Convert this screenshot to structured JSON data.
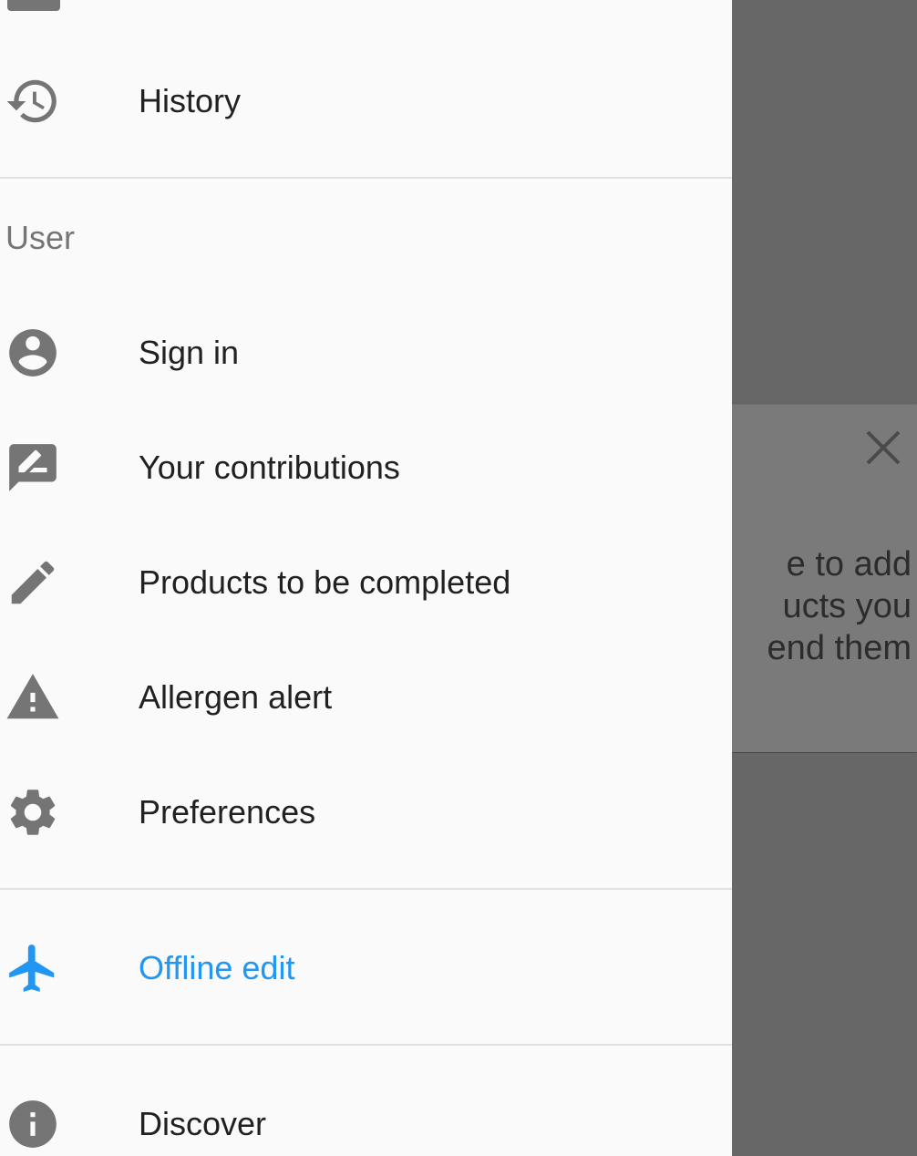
{
  "background": {
    "card_text_lines": [
      "e to add",
      "ucts you",
      "end them"
    ],
    "close_icon": "close-icon"
  },
  "drawer": {
    "history_label": "History",
    "section_user": "User",
    "items": [
      {
        "label": "Sign in",
        "icon": "account-circle-icon"
      },
      {
        "label": "Your contributions",
        "icon": "rate-review-icon"
      },
      {
        "label": "Products to be completed",
        "icon": "pencil-icon"
      },
      {
        "label": "Allergen alert",
        "icon": "warning-icon"
      },
      {
        "label": "Preferences",
        "icon": "gear-icon"
      }
    ],
    "offline_edit_label": "Offline edit",
    "discover_label": "Discover"
  },
  "colors": {
    "accent": "#2196f3",
    "icon": "#757575",
    "text": "#212121",
    "scrim": "#666666"
  }
}
